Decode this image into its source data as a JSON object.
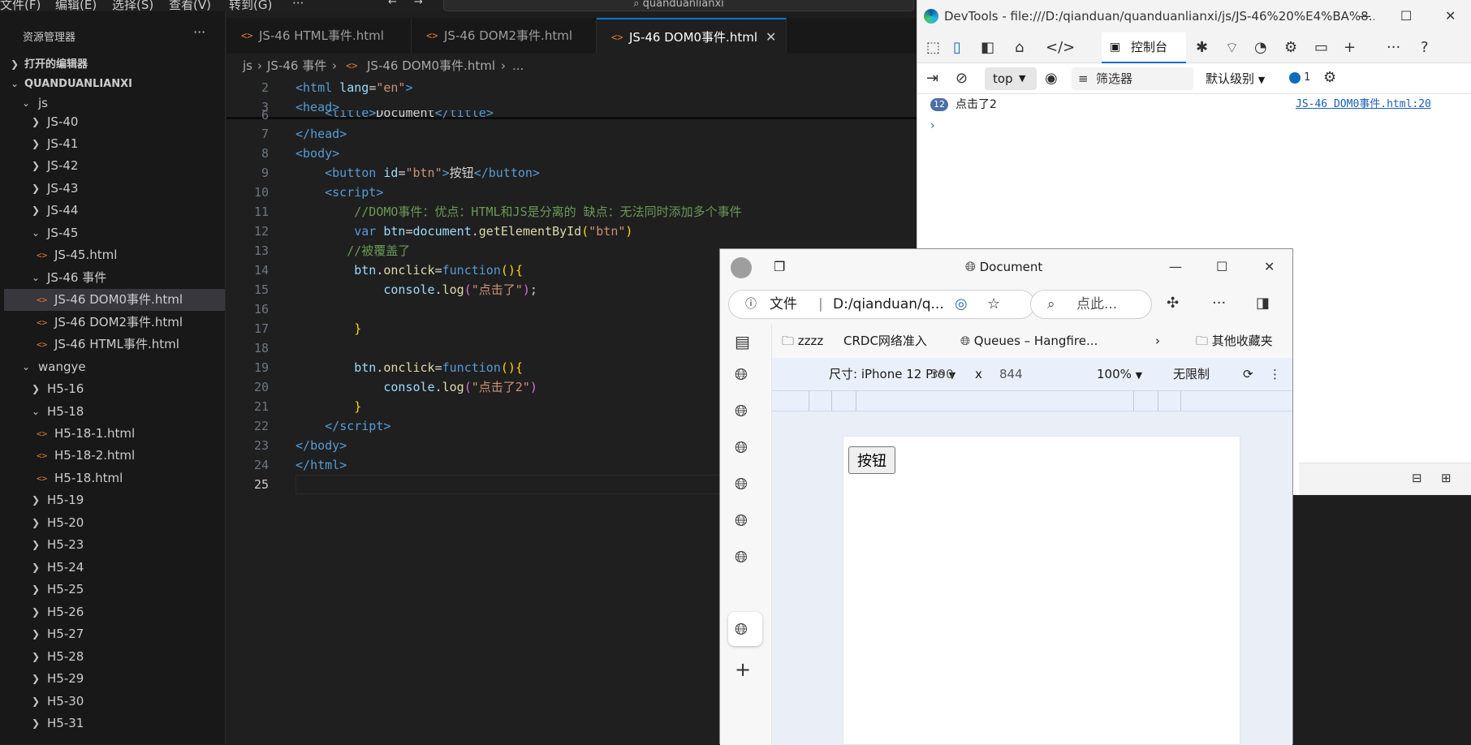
{
  "vscode": {
    "menu": [
      "文件(F)",
      "编辑(E)",
      "选择(S)",
      "查看(V)",
      "转到(G)",
      "···"
    ],
    "command_center": "quanduanlianxi",
    "sidebar": {
      "title": "资源管理器",
      "open_editors": "打开的编辑器",
      "root": "QUANDUANLIANXI",
      "items": [
        "js",
        "JS-40",
        "JS-41",
        "JS-42",
        "JS-43",
        "JS-44",
        "JS-45",
        "JS-45.html",
        "JS-46 事件",
        "JS-46 DOM0事件.html",
        "JS-46 DOM2事件.html",
        "JS-46 HTML事件.html",
        "wangye",
        "H5-16",
        "H5-18",
        "H5-18-1.html",
        "H5-18-2.html",
        "H5-18.html",
        "H5-19",
        "H5-20",
        "H5-23",
        "H5-24",
        "H5-25",
        "H5-26",
        "H5-27",
        "H5-28",
        "H5-29",
        "H5-30",
        "H5-31"
      ]
    },
    "tabs": [
      "JS-46 HTML事件.html",
      "JS-46 DOM2事件.html",
      "JS-46 DOM0事件.html"
    ],
    "breadcrumb": [
      "js",
      "JS-46 事件",
      "JS-46 DOM0事件.html",
      "..."
    ],
    "line_numbers": [
      "2",
      "3",
      "6",
      "7",
      "8",
      "9",
      "10",
      "11",
      "12",
      "13",
      "14",
      "15",
      "16",
      "17",
      "18",
      "19",
      "20",
      "21",
      "22",
      "23",
      "24",
      "25"
    ],
    "code": {
      "l2": [
        "<",
        "html",
        " lang",
        "=",
        "\"en\"",
        ">"
      ],
      "l3": [
        "<",
        "head",
        ">"
      ],
      "l6": [
        "    <",
        "title",
        ">",
        "Document",
        "</",
        "title",
        ">"
      ],
      "l7": [
        "</",
        "head",
        ">"
      ],
      "l8": [
        "<",
        "body",
        ">"
      ],
      "l9": [
        "    <",
        "button",
        " id",
        "=",
        "\"btn\"",
        ">",
        "按钮",
        "</",
        "button",
        ">"
      ],
      "l10": [
        "    <",
        "script",
        ">"
      ],
      "l11": "        //DOMO事件：优点：HTML和JS是分离的 缺点：无法同时添加多个事件",
      "l12": [
        "        ",
        "var",
        " btn",
        "=",
        "document",
        ".",
        "getElementById",
        "(",
        "\"btn\"",
        ")"
      ],
      "l13": "       //被覆盖了",
      "l14": [
        "        ",
        "btn",
        ".",
        "onclick",
        "=",
        "function",
        "(",
        ")",
        "{"
      ],
      "l15": [
        "            ",
        "console",
        ".",
        "log",
        "(",
        "\"点击了\"",
        ")",
        ";"
      ],
      "l17": [
        "        ",
        "}"
      ],
      "l19": [
        "        ",
        "btn",
        ".",
        "onclick",
        "=",
        "function",
        "(",
        ")",
        "{"
      ],
      "l20": [
        "            ",
        "console",
        ".",
        "log",
        "(",
        "\"点击了2\"",
        ")"
      ],
      "l21": [
        "        ",
        "}"
      ],
      "l22": [
        "    </",
        "script",
        ">"
      ],
      "l23": [
        "</",
        "body",
        ">"
      ],
      "l24": [
        "</",
        "html",
        ">"
      ]
    }
  },
  "devtools": {
    "title": "DevTools - file:///D:/qianduan/quanduanlianxi/js/JS-46%20%E4%BA%8...",
    "console_tab": "控制台",
    "context": "top",
    "filter_placeholder": "筛选器",
    "level": "默认级别",
    "issues_count": "1",
    "log": {
      "count": "12",
      "message": "点击了2",
      "source": "JS-46 DOM0事件.html:20"
    },
    "prompt": "›"
  },
  "browser": {
    "title": "Document",
    "address_scheme": "文件",
    "address_url": "D:/qianduan/q...",
    "search_placeholder": "点此...",
    "bookmarks": [
      "zzzz",
      "CRDC网络准入",
      "Queues – Hangfire...",
      "其他收藏夹"
    ],
    "emulation": {
      "device": "尺寸: iPhone 12 Pro",
      "width": "390",
      "times": "x",
      "height": "844",
      "zoom": "100%",
      "throttle": "无限制"
    },
    "page_button": "按钮"
  },
  "colors": {
    "accent": "#0078d4",
    "editor_bg": "#1f1f1f",
    "sidebar_bg": "#181818",
    "html_icon": "#e37933"
  }
}
